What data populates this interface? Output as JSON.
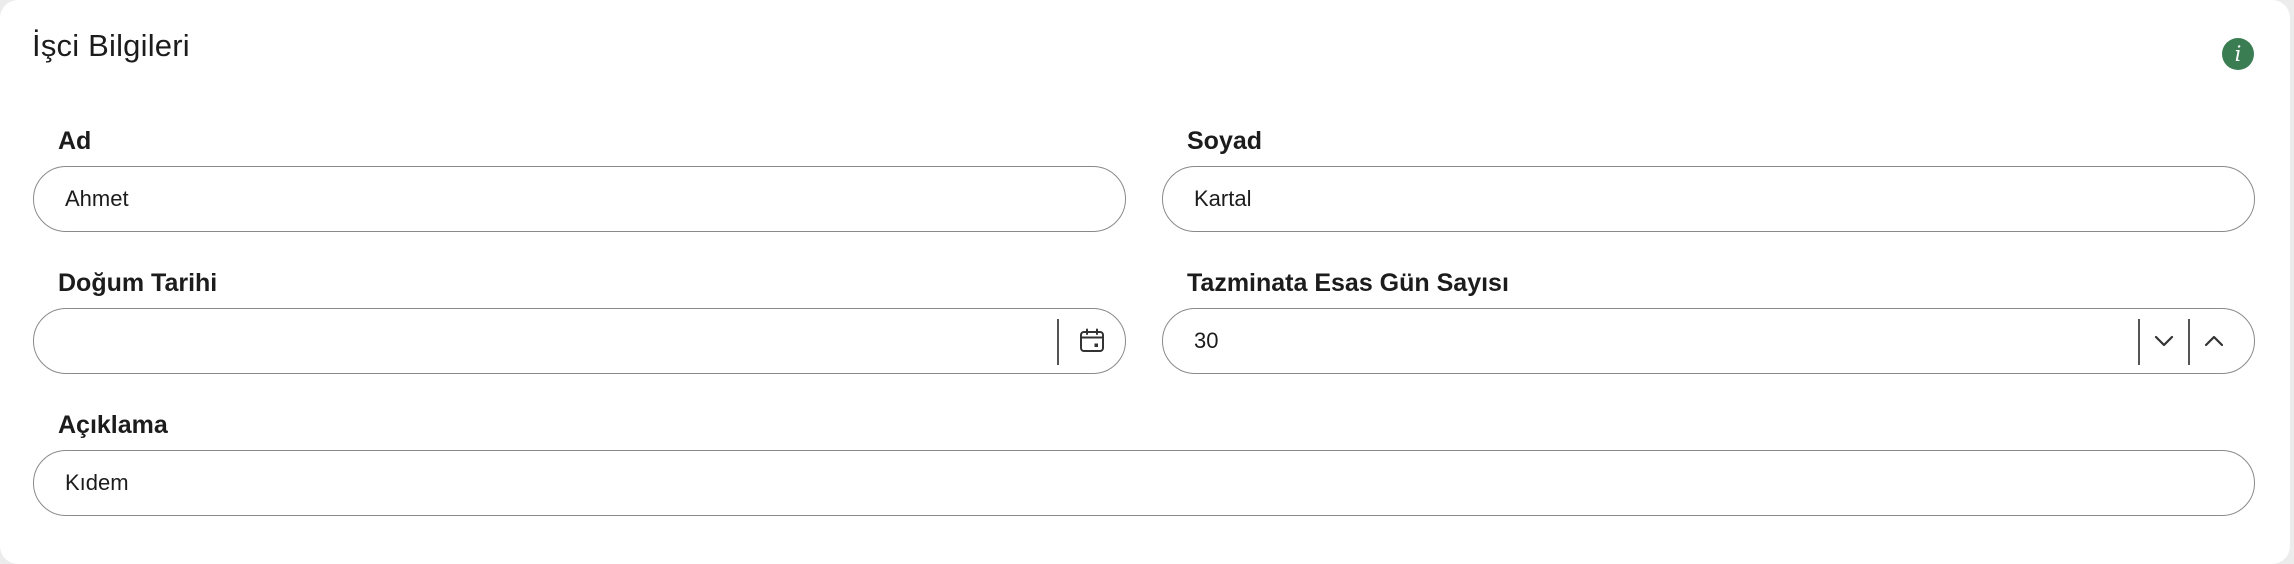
{
  "card": {
    "title": "İşci Bilgileri",
    "info_icon": "info-icon",
    "accent_color": "#3a7d53"
  },
  "fields": {
    "first_name": {
      "label": "Ad",
      "value": "Ahmet"
    },
    "last_name": {
      "label": "Soyad",
      "value": "Kartal"
    },
    "birth_date": {
      "label": "Doğum Tarihi",
      "value": "",
      "icon": "calendar-icon"
    },
    "severance_days": {
      "label": "Tazminata Esas Gün Sayısı",
      "value": "30",
      "decrement_icon": "chevron-down-icon",
      "increment_icon": "chevron-up-icon"
    },
    "description": {
      "label": "Açıklama",
      "value": "Kıdem"
    }
  }
}
